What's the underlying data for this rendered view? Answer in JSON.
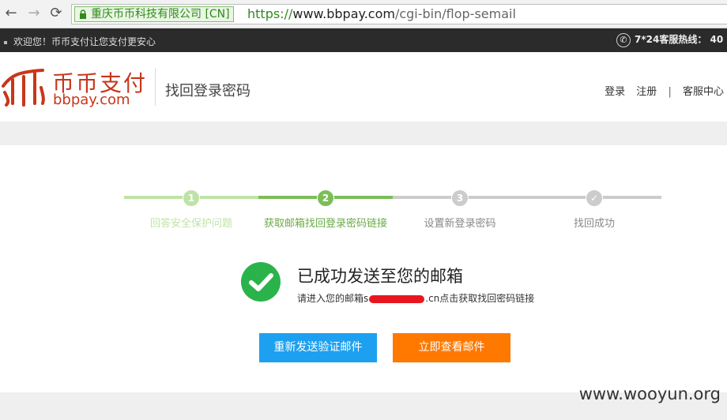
{
  "browser": {
    "back_icon": "←",
    "forward_icon": "→",
    "reload_icon": "⟳",
    "ev_certificate": "重庆币币科技有限公司 [CN]",
    "url_scheme": "https://",
    "url_host": "www.bbpay.com",
    "url_path": "/cgi-bin/flop-semail"
  },
  "topbar": {
    "welcome": "欢迎您！币币支付让您支付更安心",
    "hotline": "7*24客服热线：  40"
  },
  "header": {
    "logo_cn": "币币支付",
    "logo_en": "bbpay.com",
    "page_title": "找回登录密码",
    "links": {
      "login": "登录",
      "register": "注册",
      "separator": "|",
      "service": "客服中心"
    }
  },
  "steps": [
    {
      "number": "1",
      "label": "回答安全保护问题",
      "state": "done",
      "color": "#bfe3a6"
    },
    {
      "number": "2",
      "label": "获取邮箱找回登录密码链接",
      "state": "current",
      "color": "#7cbe56"
    },
    {
      "number": "3",
      "label": "设置新登录密码",
      "state": "todo",
      "color": "#cccccc"
    },
    {
      "number": "✓",
      "label": "找回成功",
      "state": "todo",
      "color": "#cccccc"
    }
  ],
  "success": {
    "title": "已成功发送至您的邮箱",
    "desc_prefix": "请进入您的邮箱s",
    "desc_suffix": ".cn点击获取找回密码链接"
  },
  "buttons": {
    "resend": "重新发送验证邮件",
    "view": "立即查看邮件"
  },
  "watermark": "www.wooyun.org",
  "colors": {
    "accent_green": "#7cbe56",
    "resend_blue": "#1ea0f0",
    "view_orange": "#ff7800",
    "brand_red": "#c8361a"
  }
}
